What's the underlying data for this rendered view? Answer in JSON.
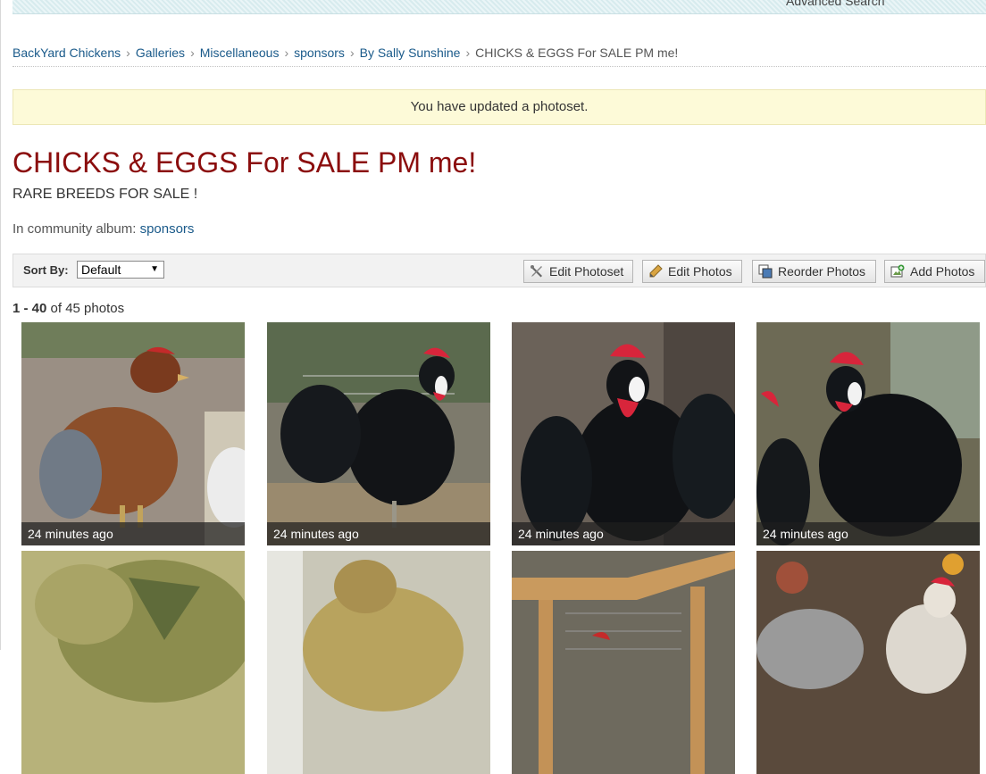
{
  "header": {
    "advanced_search": "Advanced Search"
  },
  "breadcrumb": {
    "items": [
      "BackYard Chickens",
      "Galleries",
      "Miscellaneous",
      "sponsors",
      "By Sally Sunshine"
    ],
    "current": "CHICKS & EGGS For SALE PM me!",
    "separator": "›"
  },
  "notice": "You have updated a photoset.",
  "photoset": {
    "title": "CHICKS & EGGS For SALE PM me!",
    "description": "RARE BREEDS FOR SALE !",
    "album_prefix": "In community album:",
    "album_link": "sponsors"
  },
  "toolbar": {
    "sort_label": "Sort By:",
    "sort_value": "Default",
    "edit_photoset": "Edit Photoset",
    "edit_photos": "Edit Photos",
    "reorder_photos": "Reorder Photos",
    "add_photos": "Add Photos"
  },
  "count": {
    "range": "1 - 40",
    "of_text": "of 45 photos"
  },
  "photos": [
    {
      "caption": "24 minutes ago",
      "subject": "brown-hen"
    },
    {
      "caption": "24 minutes ago",
      "subject": "black-rooster"
    },
    {
      "caption": "24 minutes ago",
      "subject": "black-rooster"
    },
    {
      "caption": "24 minutes ago",
      "subject": "black-rooster"
    },
    {
      "caption": "",
      "subject": "chick"
    },
    {
      "caption": "",
      "subject": "chick"
    },
    {
      "caption": "",
      "subject": "coop"
    },
    {
      "caption": "",
      "subject": "speckled-rooster"
    }
  ],
  "colors": {
    "title": "#8b0d0d",
    "link": "#1a5a8a",
    "notice_bg": "#fdfad8"
  }
}
